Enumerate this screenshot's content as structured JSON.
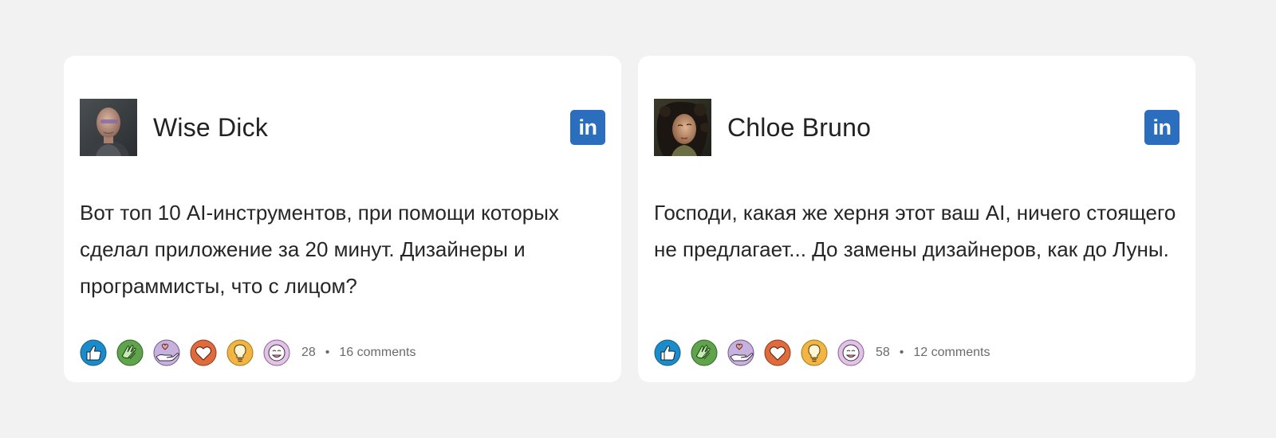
{
  "posts": [
    {
      "author": "Wise Dick",
      "avatar_icon": "avatar-bald-man-glasses",
      "network_icon": "linkedin-icon",
      "network_label": "in",
      "text": "Вот топ 10 AI-инструментов, при помощи которых сделал приложение за 20 минут. Дизайнеры и программисты, что с лицом?",
      "reactions_count": "28",
      "separator": "•",
      "comments": "16 comments"
    },
    {
      "author": "Chloe Bruno",
      "avatar_icon": "avatar-woman-curly-hair",
      "network_icon": "linkedin-icon",
      "network_label": "in",
      "text": "Господи, какая же херня этот ваш AI, ничего стоящего не предлагает... До замены дизайнеров, как до Луны.",
      "reactions_count": "58",
      "separator": "•",
      "comments": "12 comments"
    }
  ],
  "reaction_icons": [
    "like-icon",
    "celebrate-icon",
    "support-icon",
    "love-icon",
    "insightful-icon",
    "funny-icon"
  ],
  "colors": {
    "background": "#f2f2f2",
    "card": "#ffffff",
    "linkedin_blue": "#2a6ebd",
    "text": "#262626",
    "muted": "#6b6b6b"
  }
}
